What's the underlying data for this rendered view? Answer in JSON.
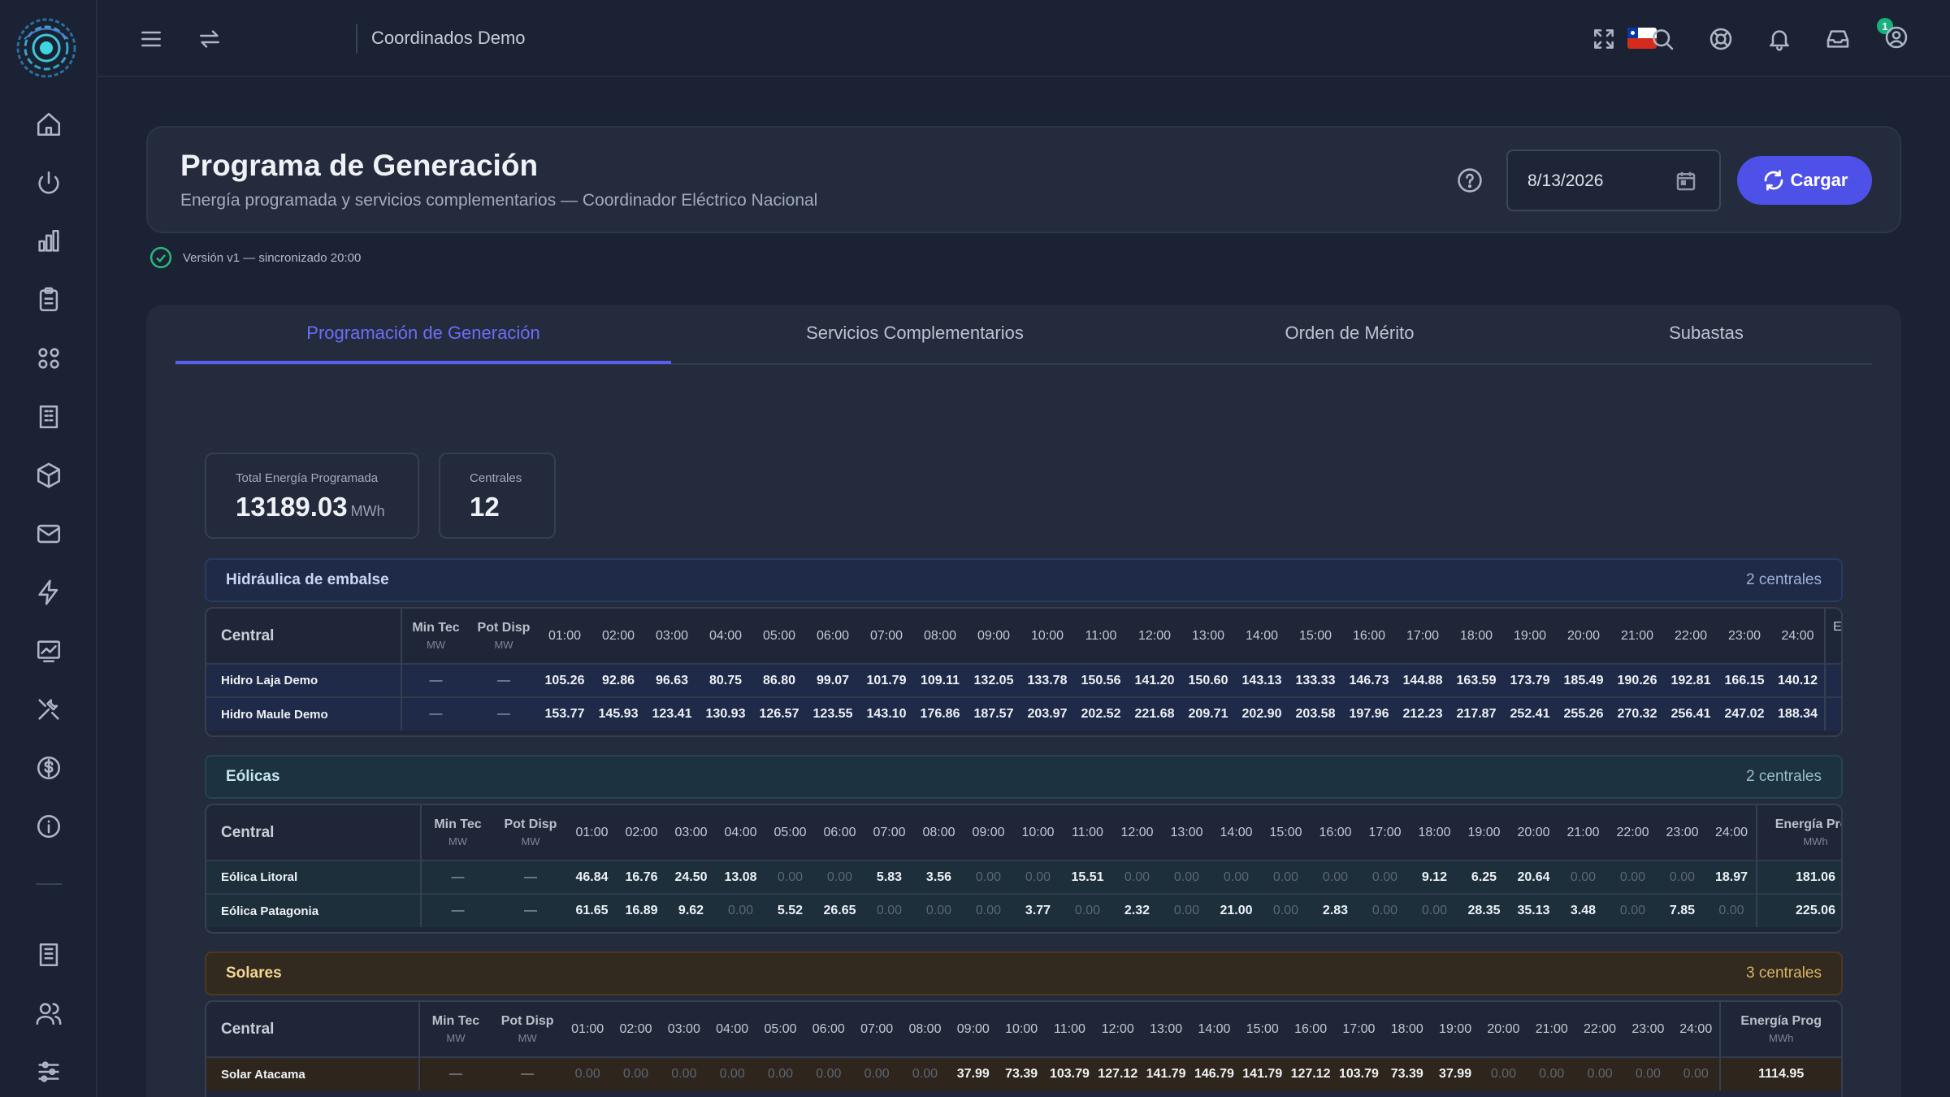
{
  "topbar": {
    "title": "Coordinados Demo",
    "notifications_count": "1"
  },
  "header": {
    "title": "Programa de Generación",
    "subtitle": "Energía programada y servicios complementarios — Coordinador Eléctrico Nacional",
    "date_value": "8/13/2026",
    "load_label": "Cargar"
  },
  "version_text": "Versión v1 — sincronizado 20:00",
  "tabs": [
    "Programación de Generación",
    "Servicios Complementarios",
    "Orden de Mérito",
    "Subastas"
  ],
  "kpis": [
    {
      "label": "Total Energía Programada",
      "value": "13189.03",
      "unit": "MWh"
    },
    {
      "label": "Centrales",
      "value": "12",
      "unit": ""
    }
  ],
  "table_labels": {
    "central": "Central",
    "min_tec": "Min Tec",
    "pot_disp": "Pot Disp",
    "unit_mw": "MW",
    "energia_prog": "Energía Prog",
    "unit_mwh": "MWh",
    "energia_prog_partial": "E",
    "dash": "—"
  },
  "hours": [
    "01:00",
    "02:00",
    "03:00",
    "04:00",
    "05:00",
    "06:00",
    "07:00",
    "08:00",
    "09:00",
    "10:00",
    "11:00",
    "12:00",
    "13:00",
    "14:00",
    "15:00",
    "16:00",
    "17:00",
    "18:00",
    "19:00",
    "20:00",
    "21:00",
    "22:00",
    "23:00",
    "24:00"
  ],
  "groups": [
    {
      "name": "Hidráulica de embalse",
      "count": "2 centrales",
      "theme": "blue",
      "rows": [
        {
          "name": "Hidro Laja Demo",
          "min_tec": "—",
          "pot_disp": "—",
          "values": [
            "105.26",
            "92.86",
            "96.63",
            "80.75",
            "86.80",
            "99.07",
            "101.79",
            "109.11",
            "132.05",
            "133.78",
            "150.56",
            "141.20",
            "150.60",
            "143.13",
            "133.33",
            "146.73",
            "144.88",
            "163.59",
            "173.79",
            "185.49",
            "190.26",
            "192.81",
            "166.15",
            "140.12"
          ]
        },
        {
          "name": "Hidro Maule Demo",
          "min_tec": "—",
          "pot_disp": "—",
          "values": [
            "153.77",
            "145.93",
            "123.41",
            "130.93",
            "126.57",
            "123.55",
            "143.10",
            "176.86",
            "187.57",
            "203.97",
            "202.52",
            "221.68",
            "209.71",
            "202.90",
            "203.58",
            "197.96",
            "212.23",
            "217.87",
            "252.41",
            "255.26",
            "270.32",
            "256.41",
            "247.02",
            "188.34"
          ]
        }
      ]
    },
    {
      "name": "Eólicas",
      "count": "2 centrales",
      "theme": "teal",
      "rows": [
        {
          "name": "Eólica Litoral",
          "min_tec": "—",
          "pot_disp": "—",
          "values": [
            "46.84",
            "16.76",
            "24.50",
            "13.08",
            "0.00",
            "0.00",
            "5.83",
            "3.56",
            "0.00",
            "0.00",
            "15.51",
            "0.00",
            "0.00",
            "0.00",
            "0.00",
            "0.00",
            "0.00",
            "9.12",
            "6.25",
            "20.64",
            "0.00",
            "0.00",
            "0.00",
            "18.97"
          ],
          "energia": "181.06"
        },
        {
          "name": "Eólica Patagonia",
          "min_tec": "—",
          "pot_disp": "—",
          "values": [
            "61.65",
            "16.89",
            "9.62",
            "0.00",
            "5.52",
            "26.65",
            "0.00",
            "0.00",
            "0.00",
            "3.77",
            "0.00",
            "2.32",
            "0.00",
            "21.00",
            "0.00",
            "2.83",
            "0.00",
            "0.00",
            "28.35",
            "35.13",
            "3.48",
            "0.00",
            "7.85",
            "0.00"
          ],
          "energia": "225.06"
        }
      ]
    },
    {
      "name": "Solares",
      "count": "3 centrales",
      "theme": "amber",
      "rows": [
        {
          "name": "Solar Atacama",
          "min_tec": "—",
          "pot_disp": "—",
          "values": [
            "0.00",
            "0.00",
            "0.00",
            "0.00",
            "0.00",
            "0.00",
            "0.00",
            "0.00",
            "37.99",
            "73.39",
            "103.79",
            "127.12",
            "141.79",
            "146.79",
            "141.79",
            "127.12",
            "103.79",
            "73.39",
            "37.99",
            "0.00",
            "0.00",
            "0.00",
            "0.00",
            "0.00"
          ],
          "energia": "1114.95"
        }
      ]
    }
  ],
  "colors": {
    "accent": "#5a5df0",
    "success": "#28b77e",
    "badge": "#18b07d"
  }
}
